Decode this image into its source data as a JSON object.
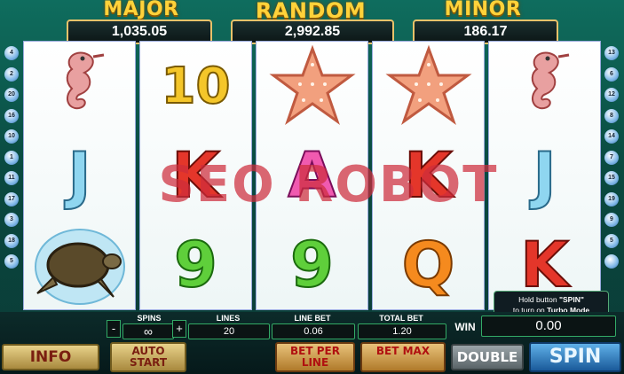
{
  "jackpots": [
    {
      "title": "MAJOR",
      "value": "1,035.05"
    },
    {
      "title": "RANDOM",
      "value": "2,992.85"
    },
    {
      "title": "MINOR",
      "value": "186.17"
    }
  ],
  "reels": [
    [
      {
        "sym": "seahorse-icon",
        "text": ""
      },
      {
        "sym": "letter",
        "text": "J",
        "cls": "s-J"
      },
      {
        "sym": "turtle-icon",
        "text": ""
      }
    ],
    [
      {
        "sym": "letter",
        "text": "10",
        "cls": "s-10"
      },
      {
        "sym": "letter",
        "text": "K",
        "cls": "s-K"
      },
      {
        "sym": "letter",
        "text": "9",
        "cls": "s-9"
      }
    ],
    [
      {
        "sym": "starfish-icon",
        "text": ""
      },
      {
        "sym": "letter",
        "text": "A",
        "cls": "s-A"
      },
      {
        "sym": "letter",
        "text": "9",
        "cls": "s-9"
      }
    ],
    [
      {
        "sym": "starfish-icon",
        "text": ""
      },
      {
        "sym": "letter",
        "text": "K",
        "cls": "s-K"
      },
      {
        "sym": "letter",
        "text": "Q",
        "cls": "s-Q"
      }
    ],
    [
      {
        "sym": "seahorse-icon",
        "text": ""
      },
      {
        "sym": "letter",
        "text": "J",
        "cls": "s-J"
      },
      {
        "sym": "letter",
        "text": "K",
        "cls": "s-K"
      }
    ]
  ],
  "paylines_left": [
    "4",
    "2",
    "20",
    "16",
    "10",
    "1",
    "11",
    "17",
    "3",
    "18",
    "5"
  ],
  "paylines_right": [
    "13",
    "6",
    "12",
    "8",
    "14",
    "7",
    "15",
    "19",
    "9",
    "5",
    ""
  ],
  "watermark": "SEO ROBOT",
  "hint": {
    "line1_pre": "Hold button ",
    "line1_key": "\"SPIN\"",
    "line2_pre": "to turn on ",
    "line2_key": "Turbo Mode"
  },
  "controls": {
    "spins_label": "SPINS",
    "spins_value": "∞",
    "minus": "-",
    "plus": "+",
    "lines_label": "LINES",
    "lines_value": "20",
    "linebet_label": "LINE BET",
    "linebet_value": "0.06",
    "totalbet_label": "TOTAL BET",
    "totalbet_value": "1.20",
    "win_label": "WIN",
    "win_value": "0.00"
  },
  "buttons": {
    "info": "INFO",
    "auto_start": "AUTO START",
    "bet_per_line": "BET PER LINE",
    "bet_max": "BET MAX",
    "double": "DOUBLE",
    "spin": "SPIN"
  }
}
